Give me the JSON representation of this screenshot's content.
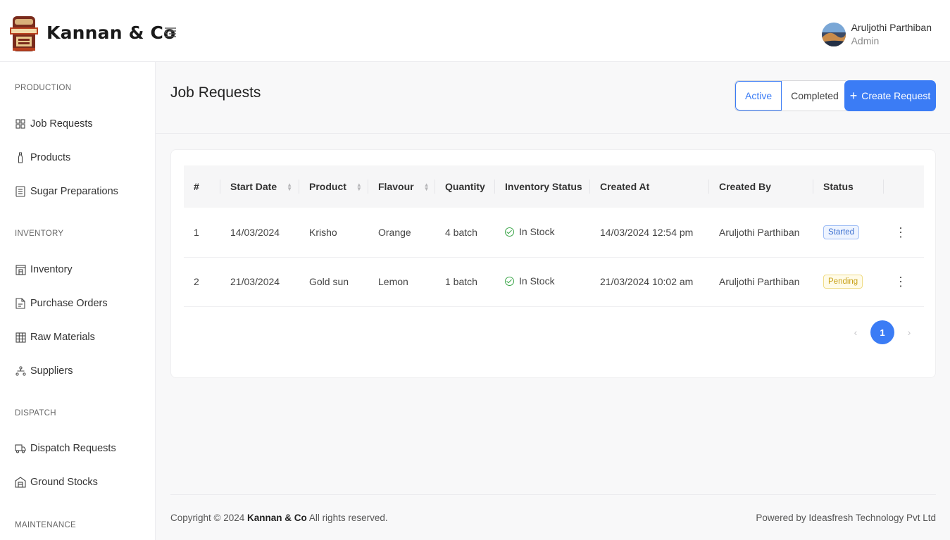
{
  "header": {
    "brand": "Kannan & Co",
    "user": {
      "name": "Aruljothi Parthiban",
      "role": "Admin"
    }
  },
  "sidebar": {
    "sections": [
      {
        "title": "PRODUCTION",
        "items": [
          {
            "label": "Job Requests",
            "icon": "grid-icon"
          },
          {
            "label": "Products",
            "icon": "bottle-icon"
          },
          {
            "label": "Sugar Preparations",
            "icon": "document-icon"
          }
        ]
      },
      {
        "title": "INVENTORY",
        "items": [
          {
            "label": "Inventory",
            "icon": "warehouse-icon"
          },
          {
            "label": "Purchase Orders",
            "icon": "invoice-icon"
          },
          {
            "label": "Raw Materials",
            "icon": "table-icon"
          },
          {
            "label": "Suppliers",
            "icon": "hierarchy-icon"
          }
        ]
      },
      {
        "title": "DISPATCH",
        "items": [
          {
            "label": "Dispatch Requests",
            "icon": "truck-icon"
          },
          {
            "label": "Ground Stocks",
            "icon": "store-icon"
          }
        ]
      },
      {
        "title": "MAINTENANCE",
        "items": []
      }
    ]
  },
  "page": {
    "title": "Job Requests",
    "tabs": [
      "Active",
      "Completed"
    ],
    "active_tab": "Active",
    "create_label": "Create Request"
  },
  "table": {
    "headers": [
      "#",
      "Start Date",
      "Product",
      "Flavour",
      "Quantity",
      "Inventory Status",
      "Created At",
      "Created By",
      "Status"
    ],
    "rows": [
      {
        "num": "1",
        "start_date": "14/03/2024",
        "product": "Krisho",
        "flavour": "Orange",
        "quantity": "4 batch",
        "inventory_status": "In Stock",
        "created_at": "14/03/2024 12:54 pm",
        "created_by": "Aruljothi Parthiban",
        "status": "Started"
      },
      {
        "num": "2",
        "start_date": "21/03/2024",
        "product": "Gold sun",
        "flavour": "Lemon",
        "quantity": "1 batch",
        "inventory_status": "In Stock",
        "created_at": "21/03/2024 10:02 am",
        "created_by": "Aruljothi Parthiban",
        "status": "Pending"
      }
    ]
  },
  "pagination": {
    "current": "1",
    "prev": "‹",
    "next": "›"
  },
  "footer": {
    "copyright_prefix": "Copyright © 2024",
    "company": "Kannan & Co",
    "copyright_suffix": "All rights reserved.",
    "powered": "Powered by Ideasfresh Technology Pvt Ltd"
  },
  "colors": {
    "primary": "#3b7cf5",
    "started": "#3b6fcf",
    "pending": "#c9a21b",
    "in_stock": "#3aa548"
  }
}
